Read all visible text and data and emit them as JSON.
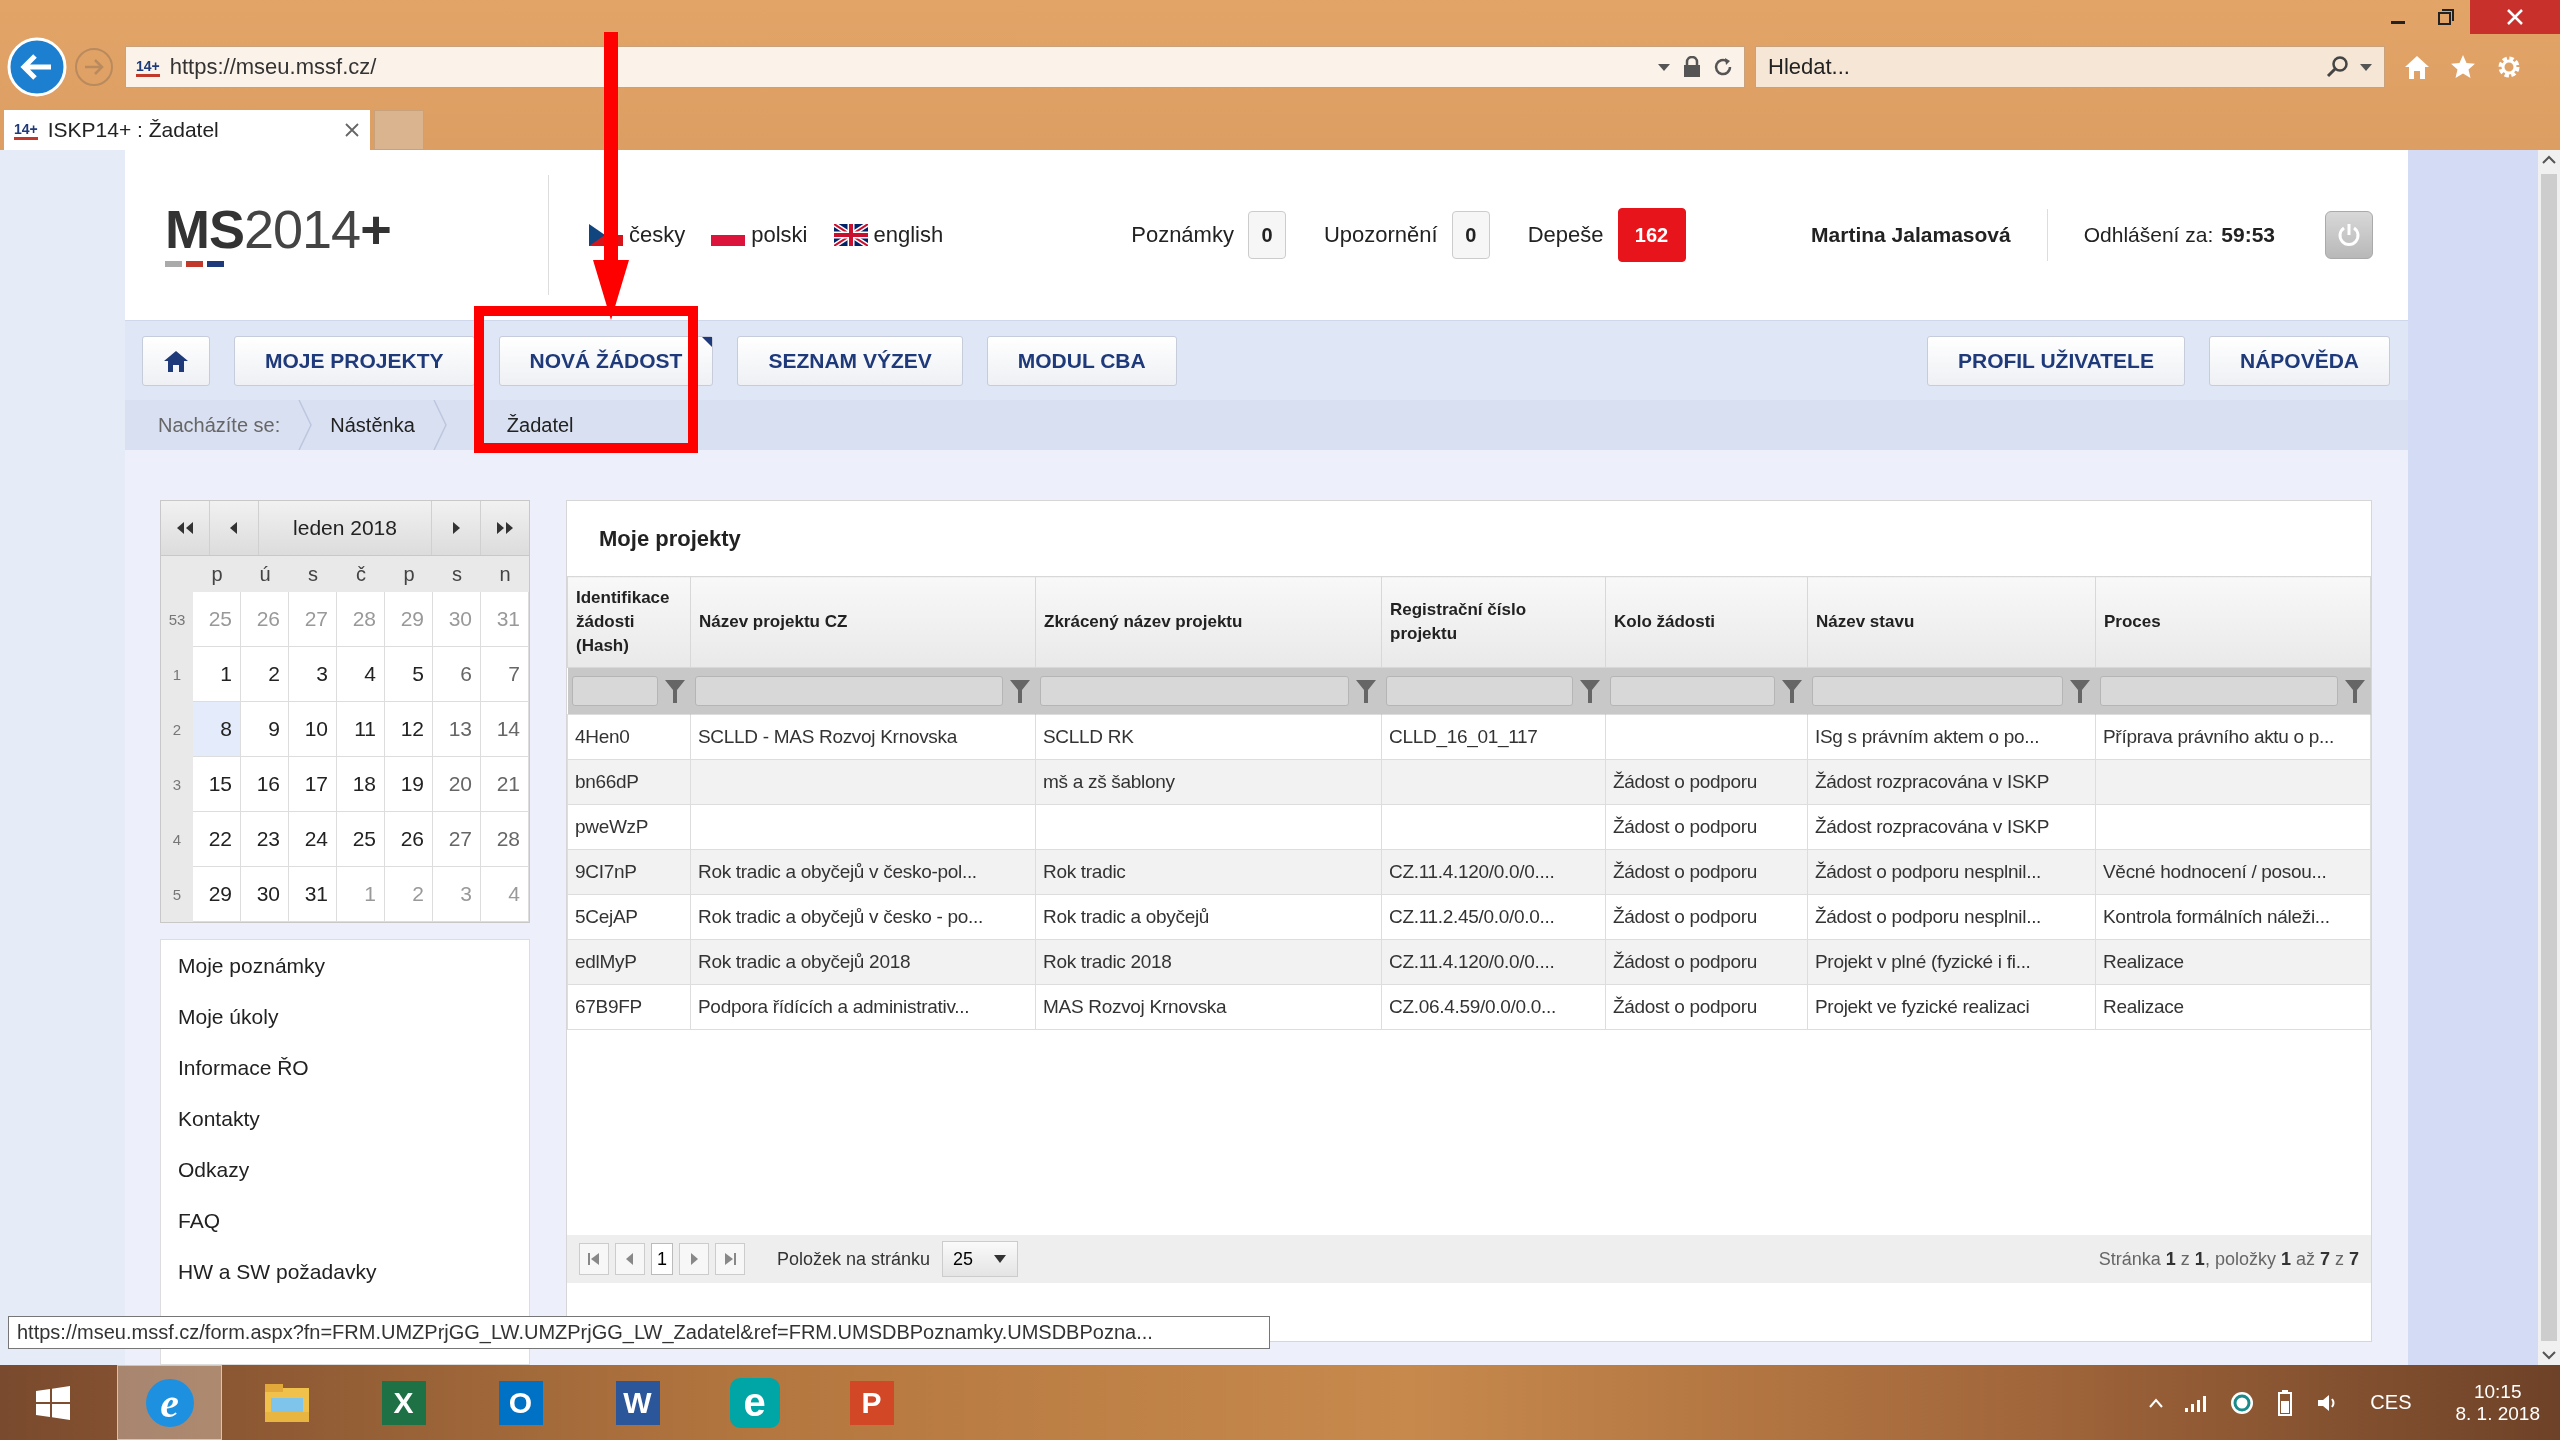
{
  "browser": {
    "address": "https://mseu.mssf.cz/",
    "search": {
      "placeholder": "Hledat..."
    },
    "tabs": [
      {
        "favicon": "14+",
        "title": "ISKP14+ : Žadatel",
        "selected": true
      }
    ],
    "address_favicon": "14+"
  },
  "header": {
    "logo": "**MS**2014**+**",
    "languages": [
      {
        "label": "česky",
        "kind": "cz"
      },
      {
        "label": "polski",
        "kind": "pl"
      },
      {
        "label": "english",
        "kind": "gb"
      }
    ],
    "counters": [
      {
        "label": "Poznámky",
        "value": "0",
        "alert": false
      },
      {
        "label": "Upozornění",
        "value": "0",
        "alert": false
      },
      {
        "label": "Depeše",
        "value": "162",
        "alert": true
      }
    ],
    "user": "Martina Jalamasová",
    "logout_label": "Odhlášení za:",
    "logout_time": "59:53"
  },
  "nav": {
    "left": [
      {
        "kind": "home"
      },
      {
        "kind": "text",
        "label": "MOJE PROJEKTY",
        "menu": false
      },
      {
        "kind": "text",
        "label": "NOVÁ ŽÁDOST",
        "menu": true
      },
      {
        "kind": "text",
        "label": "SEZNAM VÝZEV",
        "menu": false
      },
      {
        "kind": "text",
        "label": "MODUL CBA",
        "menu": false
      }
    ],
    "right": [
      {
        "kind": "text",
        "label": "PROFIL UŽIVATELE",
        "menu": false
      },
      {
        "kind": "text",
        "label": "NÁPOVĚDA",
        "menu": false
      }
    ]
  },
  "breadcrumb": {
    "label": "Nacházíte se:",
    "items": [
      "Nástěnka",
      "Žadatel"
    ]
  },
  "calendar": {
    "title": "leden 2018",
    "weekdays": [
      "p",
      "ú",
      "s",
      "č",
      "p",
      "s",
      "n"
    ],
    "weeks": [
      {
        "number": "53",
        "days": [
          {
            "d": "25",
            "other": true,
            "selected": false
          },
          {
            "d": "26",
            "other": true,
            "selected": false
          },
          {
            "d": "27",
            "other": true,
            "selected": false
          },
          {
            "d": "28",
            "other": true,
            "selected": false
          },
          {
            "d": "29",
            "other": true,
            "selected": false
          },
          {
            "d": "30",
            "other": true,
            "selected": false
          },
          {
            "d": "31",
            "other": true,
            "selected": false
          }
        ]
      },
      {
        "number": "1",
        "days": [
          {
            "d": "1",
            "other": false,
            "selected": false
          },
          {
            "d": "2",
            "other": false,
            "selected": false
          },
          {
            "d": "3",
            "other": false,
            "selected": false
          },
          {
            "d": "4",
            "other": false,
            "selected": false
          },
          {
            "d": "5",
            "other": false,
            "selected": false
          },
          {
            "d": "6",
            "other": false,
            "selected": false
          },
          {
            "d": "7",
            "other": false,
            "selected": false
          }
        ]
      },
      {
        "number": "2",
        "days": [
          {
            "d": "8",
            "other": false,
            "selected": true
          },
          {
            "d": "9",
            "other": false,
            "selected": false
          },
          {
            "d": "10",
            "other": false,
            "selected": false
          },
          {
            "d": "11",
            "other": false,
            "selected": false
          },
          {
            "d": "12",
            "other": false,
            "selected": false
          },
          {
            "d": "13",
            "other": false,
            "selected": false
          },
          {
            "d": "14",
            "other": false,
            "selected": false
          }
        ]
      },
      {
        "number": "3",
        "days": [
          {
            "d": "15",
            "other": false,
            "selected": false
          },
          {
            "d": "16",
            "other": false,
            "selected": false
          },
          {
            "d": "17",
            "other": false,
            "selected": false
          },
          {
            "d": "18",
            "other": false,
            "selected": false
          },
          {
            "d": "19",
            "other": false,
            "selected": false
          },
          {
            "d": "20",
            "other": false,
            "selected": false
          },
          {
            "d": "21",
            "other": false,
            "selected": false
          }
        ]
      },
      {
        "number": "4",
        "days": [
          {
            "d": "22",
            "other": false,
            "selected": false
          },
          {
            "d": "23",
            "other": false,
            "selected": false
          },
          {
            "d": "24",
            "other": false,
            "selected": false
          },
          {
            "d": "25",
            "other": false,
            "selected": false
          },
          {
            "d": "26",
            "other": false,
            "selected": false
          },
          {
            "d": "27",
            "other": false,
            "selected": false
          },
          {
            "d": "28",
            "other": false,
            "selected": false
          }
        ]
      },
      {
        "number": "5",
        "days": [
          {
            "d": "29",
            "other": false,
            "selected": false
          },
          {
            "d": "30",
            "other": false,
            "selected": false
          },
          {
            "d": "31",
            "other": false,
            "selected": false
          },
          {
            "d": "1",
            "other": true,
            "selected": false
          },
          {
            "d": "2",
            "other": true,
            "selected": false
          },
          {
            "d": "3",
            "other": true,
            "selected": false
          },
          {
            "d": "4",
            "other": true,
            "selected": false
          }
        ]
      }
    ]
  },
  "side_menu": [
    "Moje poznámky",
    "Moje úkoly",
    "Informace ŘO",
    "Kontakty",
    "Odkazy",
    "FAQ",
    "HW a SW požadavky"
  ],
  "projects": {
    "title": "Moje projekty",
    "columns": [
      "Identifikace žádosti (Hash)",
      "Název projektu CZ",
      "Zkrácený název projektu",
      "Registrační číslo projektu",
      "Kolo žádosti",
      "Název stavu",
      "Proces"
    ],
    "rows": [
      [
        "4Hen0",
        "SCLLD - MAS Rozvoj Krnovska",
        "SCLLD RK",
        "CLLD_16_01_117",
        null,
        "ISg s právním aktem o po...",
        "Příprava právního aktu o p..."
      ],
      [
        "bn66dP",
        null,
        "mš a zš šablony",
        null,
        "Žádost o podporu",
        "Žádost rozpracována v ISKP",
        null
      ],
      [
        "pweWzP",
        null,
        null,
        null,
        "Žádost o podporu",
        "Žádost rozpracována v ISKP",
        null
      ],
      [
        "9CI7nP",
        "Rok tradic a obyčejů v česko-pol...",
        "Rok tradic",
        "CZ.11.4.120/0.0/0....",
        "Žádost o podporu",
        "Žádost o podporu nesplnil...",
        "Věcné hodnocení / posou..."
      ],
      [
        "5CejAP",
        "Rok tradic a obyčejů v česko - po...",
        "Rok tradic a obyčejů",
        "CZ.11.2.45/0.0/0.0...",
        "Žádost o podporu",
        "Žádost o podporu nesplnil...",
        "Kontrola formálních náleži..."
      ],
      [
        "edlMyP",
        "Rok tradic a obyčejů 2018",
        "Rok tradic 2018",
        "CZ.11.4.120/0.0/0....",
        "Žádost o podporu",
        "Projekt v plné (fyzické i fi...",
        "Realizace"
      ],
      [
        "67B9FP",
        "Podpora řídících a administrativ...",
        "MAS Rozvoj Krnovska",
        "CZ.06.4.59/0.0/0.0...",
        "Žádost o podporu",
        "Projekt ve fyzické realizaci",
        "Realizace"
      ]
    ],
    "pager": {
      "page": "1",
      "page_size_label": "Položek na stránku",
      "page_size": "25",
      "summary": "Stránka **1** z **1**, položky **1** až **7** z **7**"
    }
  },
  "status_tooltip": "https://mseu.mssf.cz/form.aspx?fn=FRM.UMZPrjGG_LW.UMZPrjGG_LW_Zadatel&ref=FRM.UMSDBPoznamky.UMSDBPozna...",
  "taskbar": {
    "apps": [
      {
        "kind": "ie",
        "glyph": "e",
        "selected": true
      },
      {
        "kind": "explorer",
        "selected": false
      },
      {
        "kind": "excel",
        "glyph": "X",
        "selected": false
      },
      {
        "kind": "outlook",
        "glyph": "O",
        "selected": false
      },
      {
        "kind": "word",
        "glyph": "W",
        "selected": false
      },
      {
        "kind": "eset",
        "glyph": "e",
        "selected": false
      },
      {
        "kind": "powerpoint",
        "glyph": "P",
        "selected": false
      }
    ],
    "tray": {
      "language": "CES",
      "time": "10:15",
      "date": "8. 1. 2018"
    }
  }
}
